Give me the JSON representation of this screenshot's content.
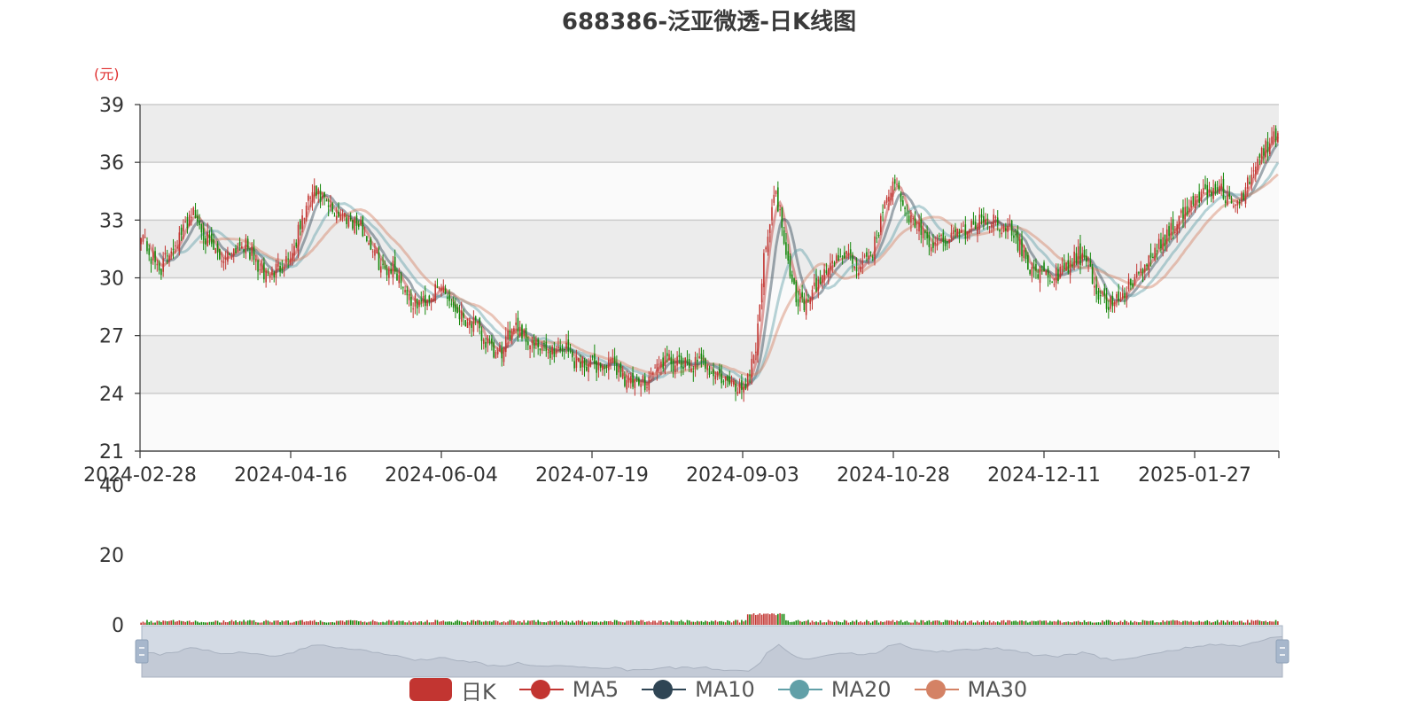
{
  "title": "688386-泛亚微透-日K线图",
  "y_unit": "(元)",
  "legend": [
    {
      "label": "日K",
      "type": "box",
      "color": "#c23531"
    },
    {
      "label": "MA5",
      "type": "line",
      "color": "#c23531"
    },
    {
      "label": "MA10",
      "type": "line",
      "color": "#2f4554"
    },
    {
      "label": "MA20",
      "type": "line",
      "color": "#61a0a8"
    },
    {
      "label": "MA30",
      "type": "line",
      "color": "#d48265"
    }
  ],
  "chart_data": {
    "type": "candlestick",
    "title": "688386-泛亚微透-日K线图",
    "x_ticks": [
      "2024-02-28",
      "2024-04-16",
      "2024-06-04",
      "2024-07-19",
      "2024-09-03",
      "2024-10-28",
      "2024-12-11",
      "2025-01-27"
    ],
    "y_ticks": [
      21,
      24,
      27,
      30,
      33,
      36,
      39
    ],
    "ylim": [
      21,
      39
    ],
    "volume_ticks": [
      0,
      20,
      40
    ],
    "volume_ylim": [
      0,
      40
    ],
    "grid": true,
    "up_color": "#c23531",
    "down_color": "#14870a",
    "close_anchors": [
      [
        0,
        32.5
      ],
      [
        5,
        31.0
      ],
      [
        10,
        30.5
      ],
      [
        15,
        31.6
      ],
      [
        20,
        32.2
      ],
      [
        25,
        33.5
      ],
      [
        30,
        32.6
      ],
      [
        35,
        31.5
      ],
      [
        40,
        31.0
      ],
      [
        45,
        31.4
      ],
      [
        50,
        31.9
      ],
      [
        55,
        31.2
      ],
      [
        60,
        30.2
      ],
      [
        65,
        30.2
      ],
      [
        70,
        30.8
      ],
      [
        75,
        31.3
      ],
      [
        80,
        33.0
      ],
      [
        85,
        34.5
      ],
      [
        90,
        34.0
      ],
      [
        95,
        33.4
      ],
      [
        100,
        33.3
      ],
      [
        105,
        33.0
      ],
      [
        110,
        32.5
      ],
      [
        115,
        31.5
      ],
      [
        120,
        30.4
      ],
      [
        125,
        30.6
      ],
      [
        130,
        29.7
      ],
      [
        135,
        28.6
      ],
      [
        140,
        28.8
      ],
      [
        145,
        29.2
      ],
      [
        150,
        29.5
      ],
      [
        155,
        28.5
      ],
      [
        160,
        28.0
      ],
      [
        165,
        27.6
      ],
      [
        170,
        26.8
      ],
      [
        175,
        26.0
      ],
      [
        180,
        26.2
      ],
      [
        185,
        27.8
      ],
      [
        190,
        27.0
      ],
      [
        195,
        26.4
      ],
      [
        200,
        26.2
      ],
      [
        205,
        26.2
      ],
      [
        210,
        26.5
      ],
      [
        215,
        25.7
      ],
      [
        220,
        25.6
      ],
      [
        225,
        25.5
      ],
      [
        230,
        25.4
      ],
      [
        235,
        25.5
      ],
      [
        240,
        24.8
      ],
      [
        245,
        24.4
      ],
      [
        250,
        24.6
      ],
      [
        255,
        25.3
      ],
      [
        260,
        25.7
      ],
      [
        265,
        25.5
      ],
      [
        270,
        25.4
      ],
      [
        275,
        25.5
      ],
      [
        280,
        25.6
      ],
      [
        285,
        25.0
      ],
      [
        290,
        24.6
      ],
      [
        295,
        24.3
      ],
      [
        300,
        24.5
      ],
      [
        305,
        26.5
      ],
      [
        310,
        32.0
      ],
      [
        315,
        34.5
      ],
      [
        320,
        31.5
      ],
      [
        325,
        29.0
      ],
      [
        330,
        28.6
      ],
      [
        335,
        29.5
      ],
      [
        340,
        30.5
      ],
      [
        345,
        31.0
      ],
      [
        350,
        31.2
      ],
      [
        355,
        30.5
      ],
      [
        360,
        30.8
      ],
      [
        365,
        32.0
      ],
      [
        370,
        34.5
      ],
      [
        375,
        34.7
      ],
      [
        380,
        33.2
      ],
      [
        385,
        32.8
      ],
      [
        390,
        31.7
      ],
      [
        395,
        31.8
      ],
      [
        400,
        32.1
      ],
      [
        405,
        32.3
      ],
      [
        410,
        32.5
      ],
      [
        415,
        32.8
      ],
      [
        420,
        33.1
      ],
      [
        425,
        32.9
      ],
      [
        430,
        32.6
      ],
      [
        435,
        31.8
      ],
      [
        440,
        30.7
      ],
      [
        445,
        30.3
      ],
      [
        450,
        30.0
      ],
      [
        455,
        30.1
      ],
      [
        460,
        30.6
      ],
      [
        465,
        31.2
      ],
      [
        470,
        30.4
      ],
      [
        475,
        29.2
      ],
      [
        480,
        28.6
      ],
      [
        485,
        29.0
      ],
      [
        490,
        29.5
      ],
      [
        495,
        30.2
      ],
      [
        500,
        30.8
      ],
      [
        505,
        31.6
      ],
      [
        510,
        32.4
      ],
      [
        515,
        33.0
      ],
      [
        520,
        33.6
      ],
      [
        525,
        34.3
      ],
      [
        530,
        34.5
      ],
      [
        535,
        34.6
      ],
      [
        540,
        34.0
      ],
      [
        545,
        33.7
      ],
      [
        550,
        35.2
      ],
      [
        555,
        36.5
      ],
      [
        560,
        37.0
      ],
      [
        564,
        37.6
      ]
    ],
    "slider": {
      "start": 0,
      "end": 100
    }
  }
}
